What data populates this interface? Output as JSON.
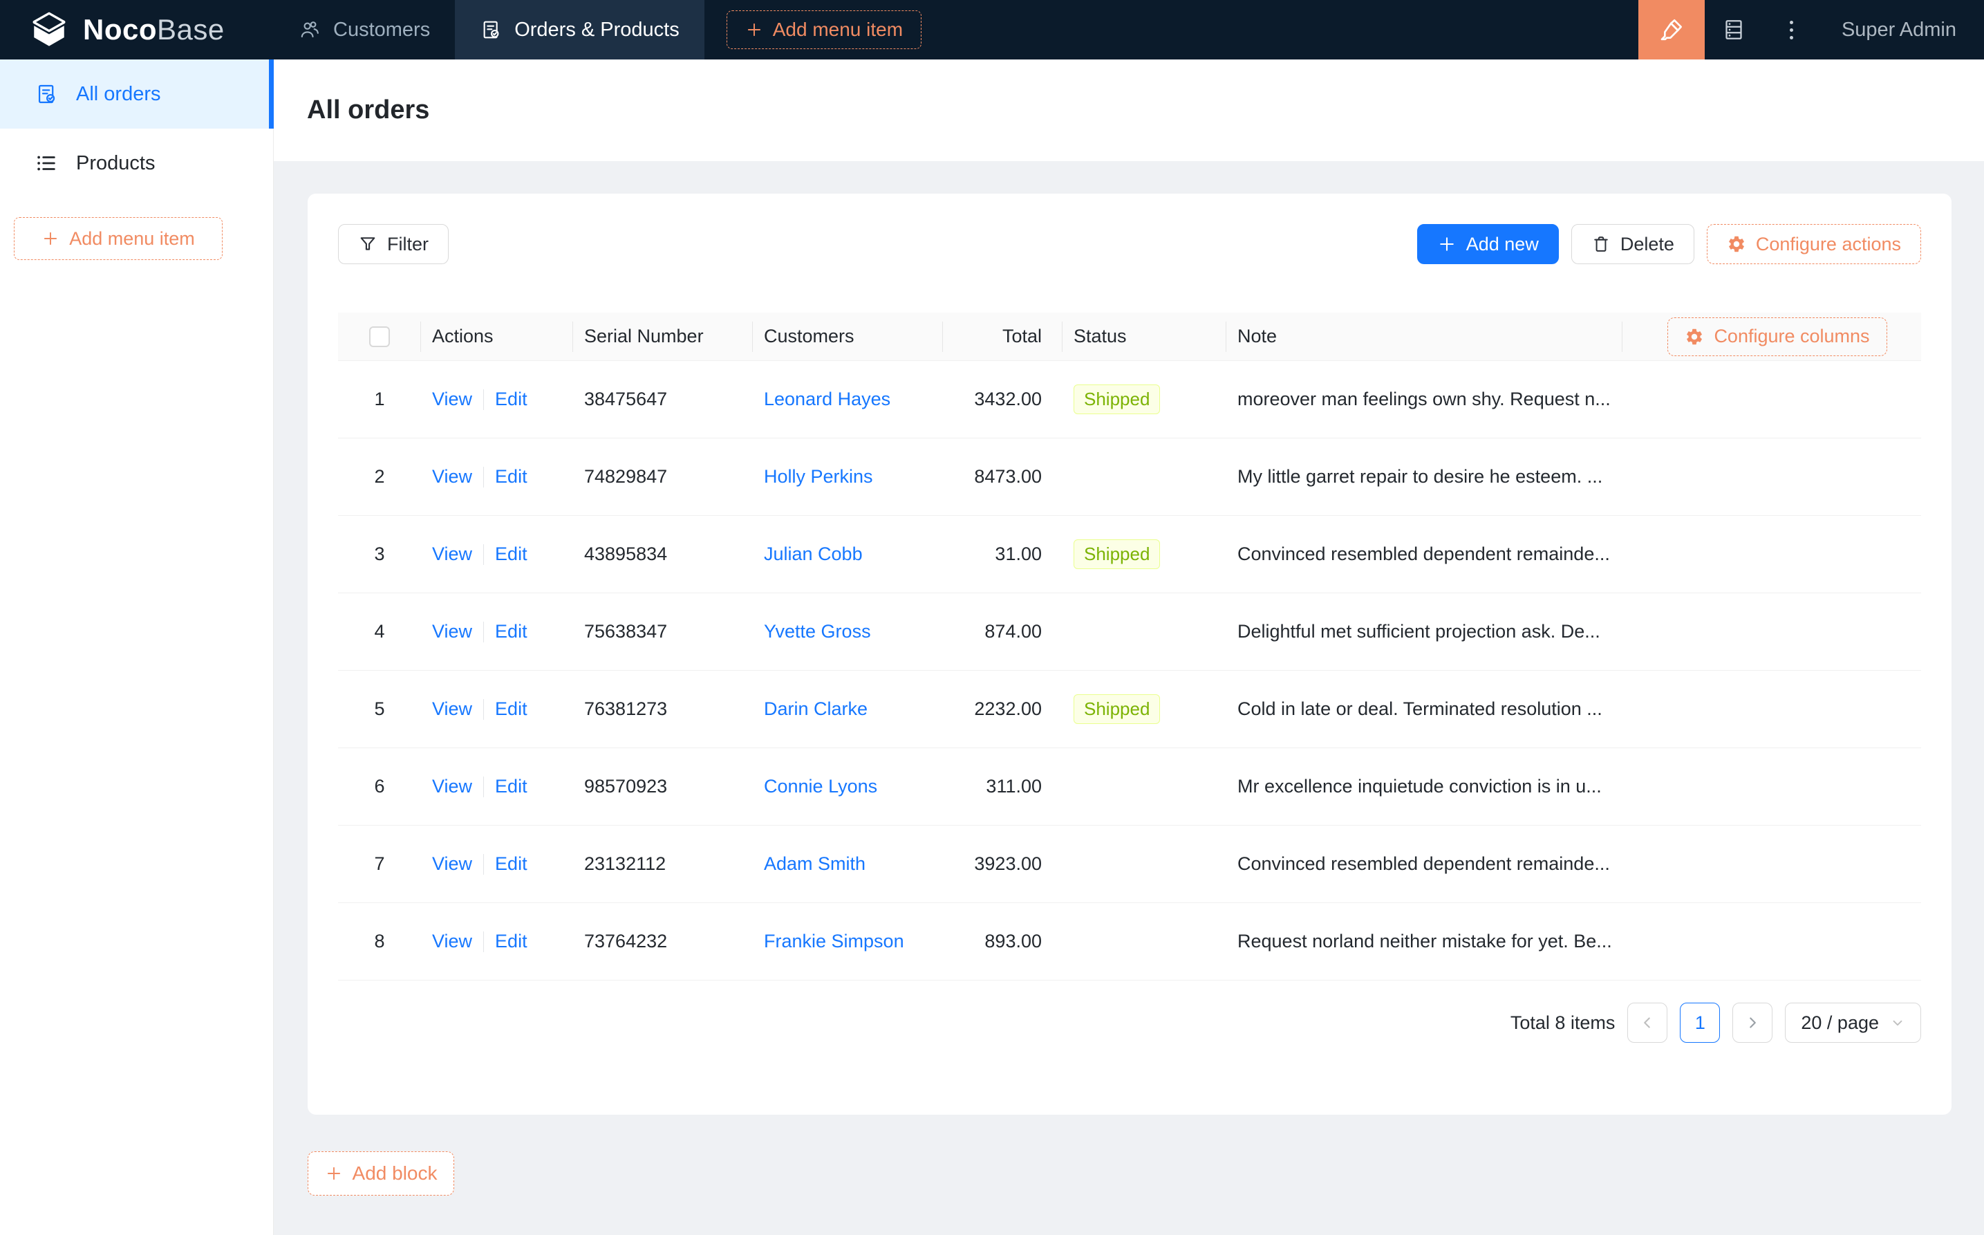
{
  "colors": {
    "accent": "#f18b62",
    "blue": "#1677ff",
    "navbar-bg": "#0b1b2b",
    "navbar-active": "#1d3045",
    "page-bg": "#eff1f4",
    "sidebar-active": "#e6f4ff",
    "tag-bg": "#fcffe6",
    "tag-border": "#eaff8f",
    "tag-text": "#7cb305"
  },
  "icons": {
    "logo": "cube-mark",
    "customers": "users-icon",
    "orders": "order-check-icon",
    "ui-editor": "highlighter-icon",
    "plugins": "database-icon",
    "more": "ellipsis-vertical-icon",
    "products": "list-icon",
    "filter": "funnel-icon",
    "add": "plus-icon",
    "delete": "trash-icon",
    "configure": "gear-icon"
  },
  "navbar": {
    "logo_primary": "Noco",
    "logo_secondary": "Base",
    "menu": [
      {
        "label": "Customers"
      },
      {
        "label": "Orders & Products"
      }
    ],
    "add_menu_item": "Add menu item",
    "user": "Super Admin"
  },
  "sidebar": {
    "items": [
      {
        "label": "All orders"
      },
      {
        "label": "Products"
      }
    ],
    "add_menu_item": "Add menu item"
  },
  "page": {
    "title": "All orders"
  },
  "toolbar": {
    "filter": "Filter",
    "add_new": "Add new",
    "delete": "Delete",
    "configure_actions": "Configure actions"
  },
  "table": {
    "header": {
      "actions": "Actions",
      "serial": "Serial Number",
      "customers": "Customers",
      "total": "Total",
      "status": "Status",
      "note": "Note",
      "configure_columns": "Configure columns"
    },
    "actions": {
      "view": "View",
      "edit": "Edit"
    },
    "rows": [
      {
        "index": "1",
        "serial": "38475647",
        "customer": "Leonard Hayes",
        "total": "3432.00",
        "status": "Shipped",
        "note": "moreover man feelings own shy. Request n..."
      },
      {
        "index": "2",
        "serial": "74829847",
        "customer": "Holly Perkins",
        "total": "8473.00",
        "status": "",
        "note": "My little garret repair to desire he esteem. ..."
      },
      {
        "index": "3",
        "serial": "43895834",
        "customer": "Julian Cobb",
        "total": "31.00",
        "status": "Shipped",
        "note": "Convinced resembled dependent remainde..."
      },
      {
        "index": "4",
        "serial": "75638347",
        "customer": "Yvette Gross",
        "total": "874.00",
        "status": "",
        "note": "Delightful met sufficient projection ask. De..."
      },
      {
        "index": "5",
        "serial": "76381273",
        "customer": "Darin Clarke",
        "total": "2232.00",
        "status": "Shipped",
        "note": "Cold in late or deal. Terminated resolution ..."
      },
      {
        "index": "6",
        "serial": "98570923",
        "customer": "Connie Lyons",
        "total": "311.00",
        "status": "",
        "note": "Mr excellence inquietude conviction is in u..."
      },
      {
        "index": "7",
        "serial": "23132112",
        "customer": "Adam Smith",
        "total": "3923.00",
        "status": "",
        "note": "Convinced resembled dependent remainde..."
      },
      {
        "index": "8",
        "serial": "73764232",
        "customer": "Frankie Simpson",
        "total": "893.00",
        "status": "",
        "note": "Request norland neither mistake for yet. Be..."
      }
    ]
  },
  "pagination": {
    "total": "Total 8 items",
    "page": "1",
    "page_size": "20 / page"
  },
  "footer": {
    "add_block": "Add block"
  }
}
